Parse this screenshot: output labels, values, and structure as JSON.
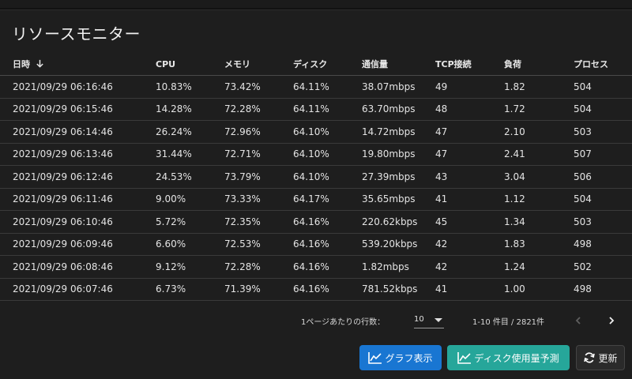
{
  "title": "リソースモニター",
  "columns": [
    "日時",
    "CPU",
    "メモリ",
    "ディスク",
    "通信量",
    "TCP接続",
    "負荷",
    "プロセス"
  ],
  "rows": [
    [
      "2021/09/29 06:16:46",
      "10.83%",
      "73.42%",
      "64.11%",
      "38.07mbps",
      "49",
      "1.82",
      "504"
    ],
    [
      "2021/09/29 06:15:46",
      "14.28%",
      "72.28%",
      "64.11%",
      "63.70mbps",
      "48",
      "1.72",
      "504"
    ],
    [
      "2021/09/29 06:14:46",
      "26.24%",
      "72.96%",
      "64.10%",
      "14.72mbps",
      "47",
      "2.10",
      "503"
    ],
    [
      "2021/09/29 06:13:46",
      "31.44%",
      "72.71%",
      "64.10%",
      "19.80mbps",
      "47",
      "2.41",
      "507"
    ],
    [
      "2021/09/29 06:12:46",
      "24.53%",
      "73.79%",
      "64.10%",
      "27.39mbps",
      "43",
      "3.04",
      "506"
    ],
    [
      "2021/09/29 06:11:46",
      "9.00%",
      "73.33%",
      "64.17%",
      "35.65mbps",
      "41",
      "1.12",
      "504"
    ],
    [
      "2021/09/29 06:10:46",
      "5.72%",
      "72.35%",
      "64.16%",
      "220.62kbps",
      "45",
      "1.34",
      "503"
    ],
    [
      "2021/09/29 06:09:46",
      "6.60%",
      "72.53%",
      "64.16%",
      "539.20kbps",
      "42",
      "1.83",
      "498"
    ],
    [
      "2021/09/29 06:08:46",
      "9.12%",
      "72.28%",
      "64.16%",
      "1.82mbps",
      "42",
      "1.24",
      "502"
    ],
    [
      "2021/09/29 06:07:46",
      "6.73%",
      "71.39%",
      "64.16%",
      "781.52kbps",
      "41",
      "1.00",
      "498"
    ]
  ],
  "pagination": {
    "rows_per_page_label": "1ページあたりの行数：",
    "rows_per_page_value": "10",
    "range_text": "1-10 件目 / 2821件"
  },
  "buttons": {
    "graph": "グラフ表示",
    "predict": "ディスク使用量予測",
    "refresh": "更新"
  },
  "colors": {
    "graph_button": "#1976d2",
    "predict_button": "#26a69a",
    "background": "#1e1e1e"
  },
  "icons": {
    "sort": "arrow-down-icon",
    "prev": "chevron-left-icon",
    "next": "chevron-right-icon",
    "graph": "line-chart-icon",
    "refresh": "refresh-icon"
  }
}
